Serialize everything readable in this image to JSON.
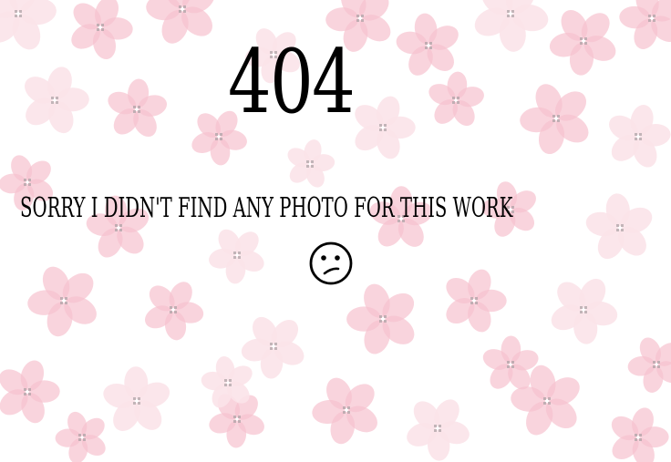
{
  "error": {
    "code": "404",
    "message": "SORRY I DIDN'T FIND ANY PHOTO FOR THIS WORK"
  },
  "icons": {
    "emoji": "confused-face-icon",
    "background": "cherry-blossom-pattern"
  },
  "colors": {
    "text": "#000000",
    "background": "#ffffff",
    "petal_light": "#fbe3e9",
    "petal": "#f6c2cf",
    "petal_center": "#a9a0a3"
  }
}
